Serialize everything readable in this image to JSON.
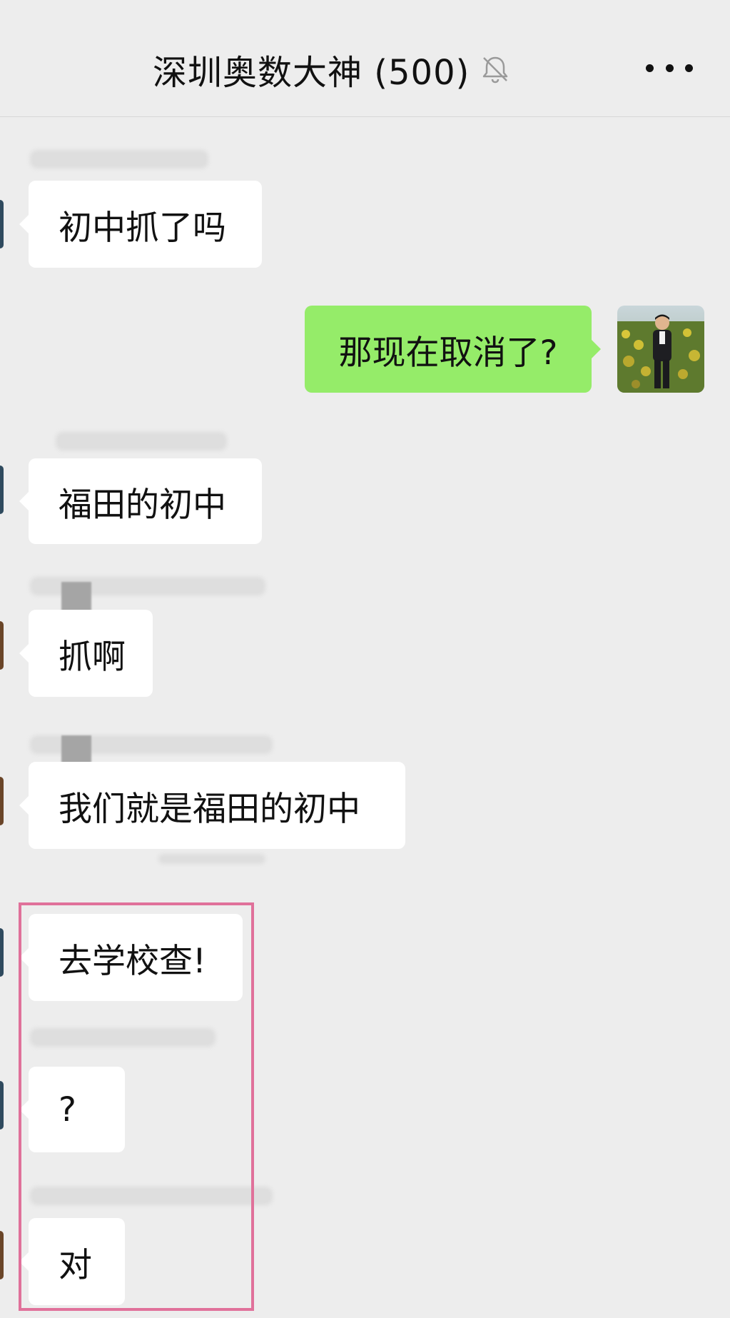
{
  "header": {
    "title": "深圳奥数大神 (500)",
    "mute_icon": "bell-off-icon",
    "more_icon": "more-dots-icon"
  },
  "messages": [
    {
      "id": 1,
      "side": "left",
      "text": "初中抓了吗"
    },
    {
      "id": 2,
      "side": "right",
      "text": "那现在取消了?"
    },
    {
      "id": 3,
      "side": "left",
      "text": "福田的初中"
    },
    {
      "id": 4,
      "side": "left",
      "text": "抓啊"
    },
    {
      "id": 5,
      "side": "left",
      "text": "我们就是福田的初中"
    },
    {
      "id": 6,
      "side": "left",
      "text": "去学校查!"
    },
    {
      "id": 7,
      "side": "left",
      "text": "?"
    },
    {
      "id": 8,
      "side": "left",
      "text": "对"
    }
  ],
  "colors": {
    "background": "#ededed",
    "bubble_incoming": "#ffffff",
    "bubble_outgoing": "#95ec69",
    "highlight_border": "#e0719a"
  }
}
